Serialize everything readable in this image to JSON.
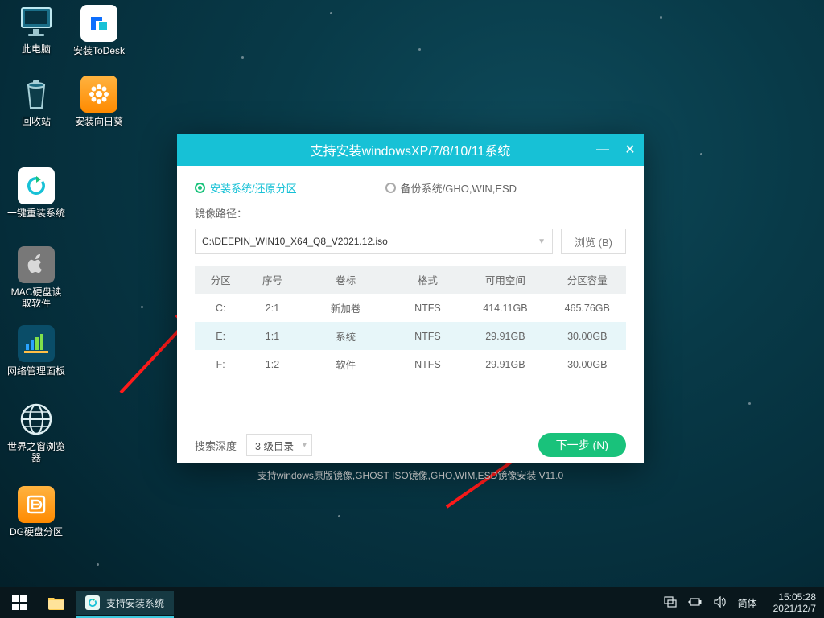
{
  "desktop": {
    "icons": [
      {
        "label": "此电脑"
      },
      {
        "label": "回收站"
      },
      {
        "label": "一键重装系统"
      },
      {
        "label": "MAC硬盘读取软件"
      },
      {
        "label": "网络管理面板"
      },
      {
        "label": "世界之窗浏览器"
      },
      {
        "label": "DG硬盘分区"
      },
      {
        "label": "安装ToDesk"
      },
      {
        "label": "安装向日葵"
      }
    ]
  },
  "window": {
    "title": "支持安装windowsXP/7/8/10/11系统",
    "mode_install": "安装系统/还原分区",
    "mode_backup": "备份系统/GHO,WIN,ESD",
    "image_path_label": "镜像路径：",
    "image_path": "C:\\DEEPIN_WIN10_X64_Q8_V2021.12.iso",
    "browse": "浏览 (B)",
    "cols": [
      "分区",
      "序号",
      "卷标",
      "格式",
      "可用空间",
      "分区容量"
    ],
    "rows": [
      {
        "part": "C:",
        "idx": "2:1",
        "label": "新加卷",
        "fs": "NTFS",
        "free": "414.11GB",
        "total": "465.76GB"
      },
      {
        "part": "E:",
        "idx": "1:1",
        "label": "系统",
        "fs": "NTFS",
        "free": "29.91GB",
        "total": "30.00GB"
      },
      {
        "part": "F:",
        "idx": "1:2",
        "label": "软件",
        "fs": "NTFS",
        "free": "29.91GB",
        "total": "30.00GB"
      }
    ],
    "depth_label": "搜索深度",
    "depth_value": "3 级目录",
    "next": "下一步 (N)",
    "footer": "支持windows原版镜像,GHOST ISO镜像,GHO,WIM,ESD镜像安装 V11.0"
  },
  "taskbar": {
    "task": "支持安装系统",
    "ime": "简体",
    "time": "15:05:28",
    "date": "2021/12/7"
  }
}
